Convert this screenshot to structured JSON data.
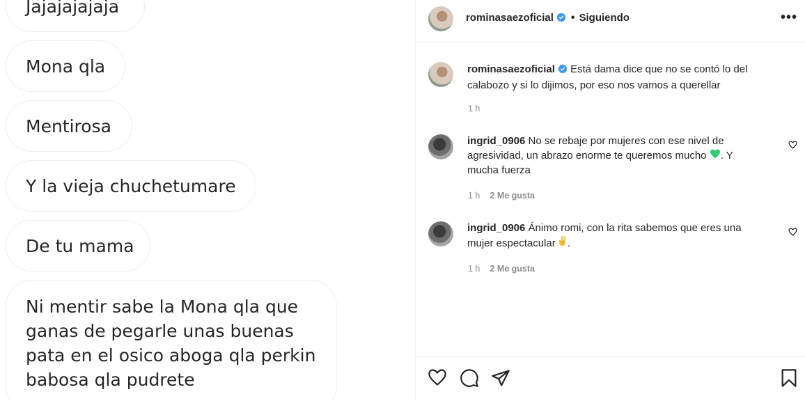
{
  "chat": {
    "messages": [
      "Jajajajajaja",
      "Mona qla",
      "Mentirosa",
      "Y  la vieja chuchetumare",
      "De tu mama"
    ],
    "long_message": [
      "Ni mentir sabe la Mona qla que",
      "ganas de pegarle unas buenas",
      "pata en el osico aboga qla perkin",
      "babosa qla pudrete"
    ]
  },
  "post": {
    "username": "rominasaezoficial",
    "separator": "•",
    "follow_status": "Siguiendo",
    "more_label": "•••",
    "verified_color": "#3897f0",
    "caption": {
      "username": "rominasaezoficial",
      "text": "Está dama dice que no se contó lo del calabozo y si lo dijimos, por eso nos vamos a querellar",
      "time": "1 h"
    },
    "comments": [
      {
        "username": "ingrid_0906",
        "text": "No se rebaje por mujeres con ese nivel de agresividad, un abrazo enorme te queremos mucho",
        "emoji": "green-heart",
        "text_after": ". Y mucha fuerza",
        "time": "1 h",
        "likes": "2 Me gusta"
      },
      {
        "username": "ingrid_0906",
        "text": "Ánimo romi, con la rita sabemos que eres una mujer espectacular",
        "emoji": "ok-hand",
        "text_after": ".",
        "time": "1 h",
        "likes": "2 Me gusta"
      }
    ],
    "action_icons": [
      "heart-icon",
      "comment-icon",
      "share-icon",
      "bookmark-icon"
    ]
  }
}
